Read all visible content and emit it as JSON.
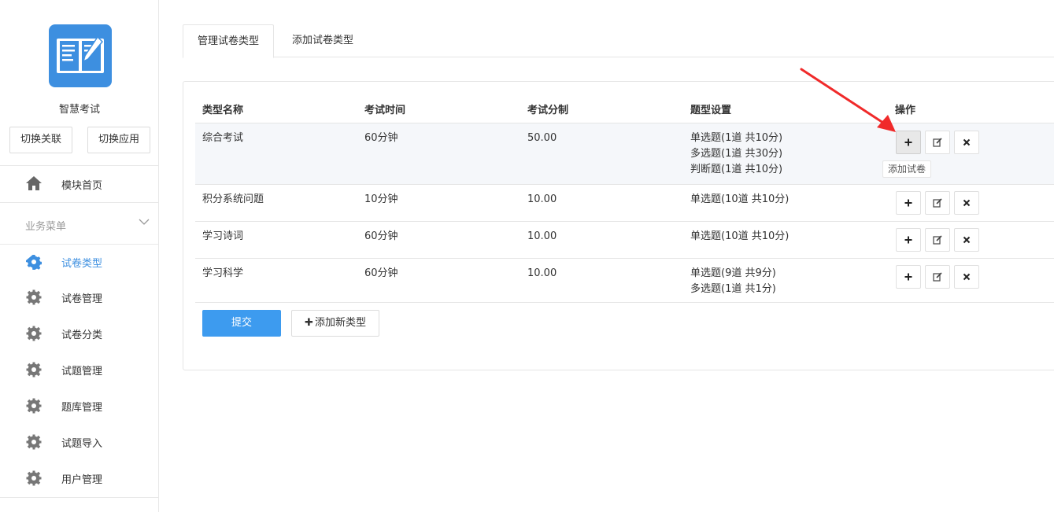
{
  "sidebar": {
    "app_name": "智慧考试",
    "switch_link_label": "切换关联",
    "switch_app_label": "切换应用",
    "home_label": "模块首页",
    "menu_title": "业务菜单",
    "items": [
      {
        "label": "试卷类型",
        "active": true
      },
      {
        "label": "试卷管理",
        "active": false
      },
      {
        "label": "试卷分类",
        "active": false
      },
      {
        "label": "试题管理",
        "active": false
      },
      {
        "label": "题库管理",
        "active": false
      },
      {
        "label": "试题导入",
        "active": false
      },
      {
        "label": "用户管理",
        "active": false
      }
    ]
  },
  "tabs": [
    {
      "label": "管理试卷类型",
      "active": true
    },
    {
      "label": "添加试卷类型",
      "active": false
    }
  ],
  "table": {
    "headers": [
      "类型名称",
      "考试时间",
      "考试分制",
      "题型设置",
      "操作"
    ],
    "rows": [
      {
        "name": "综合考试",
        "time": "60分钟",
        "score": "50.00",
        "types": [
          "单选题(1道 共10分)",
          "多选题(1道 共30分)",
          "判断题(1道 共10分)"
        ]
      },
      {
        "name": "积分系统问题",
        "time": "10分钟",
        "score": "10.00",
        "types": [
          "单选题(10道 共10分)"
        ]
      },
      {
        "name": "学习诗词",
        "time": "60分钟",
        "score": "10.00",
        "types": [
          "单选题(10道 共10分)"
        ]
      },
      {
        "name": "学习科学",
        "time": "60分钟",
        "score": "10.00",
        "types": [
          "单选题(9道 共9分)",
          "多选题(1道 共1分)"
        ]
      }
    ]
  },
  "tooltip": "添加试卷",
  "buttons": {
    "submit_label": "提交",
    "add_type_label": "添加新类型",
    "add_type_icon": "plus-icon"
  },
  "colors": {
    "accent": "#3d8fe0",
    "submit": "#3d9bef",
    "annotation_arrow": "#f02a2a"
  }
}
